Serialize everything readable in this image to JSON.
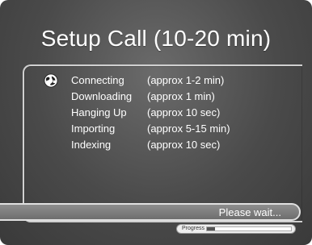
{
  "dialog": {
    "title": "Setup Call (10-20 min)"
  },
  "steps": [
    {
      "label": "Connecting",
      "time": "(approx 1-2 min)",
      "icon": "globe-icon"
    },
    {
      "label": "Downloading",
      "time": "(approx 1 min)"
    },
    {
      "label": "Hanging Up",
      "time": "(approx 10 sec)"
    },
    {
      "label": "Importing",
      "time": "(approx 5-15 min)"
    },
    {
      "label": "Indexing",
      "time": "(approx 10 sec)"
    }
  ],
  "status": {
    "text": "Please wait..."
  },
  "progress": {
    "label": "Progress",
    "fraction": 0.1
  },
  "colors": {
    "background": "#4a4a4a",
    "text": "#ffffff"
  }
}
